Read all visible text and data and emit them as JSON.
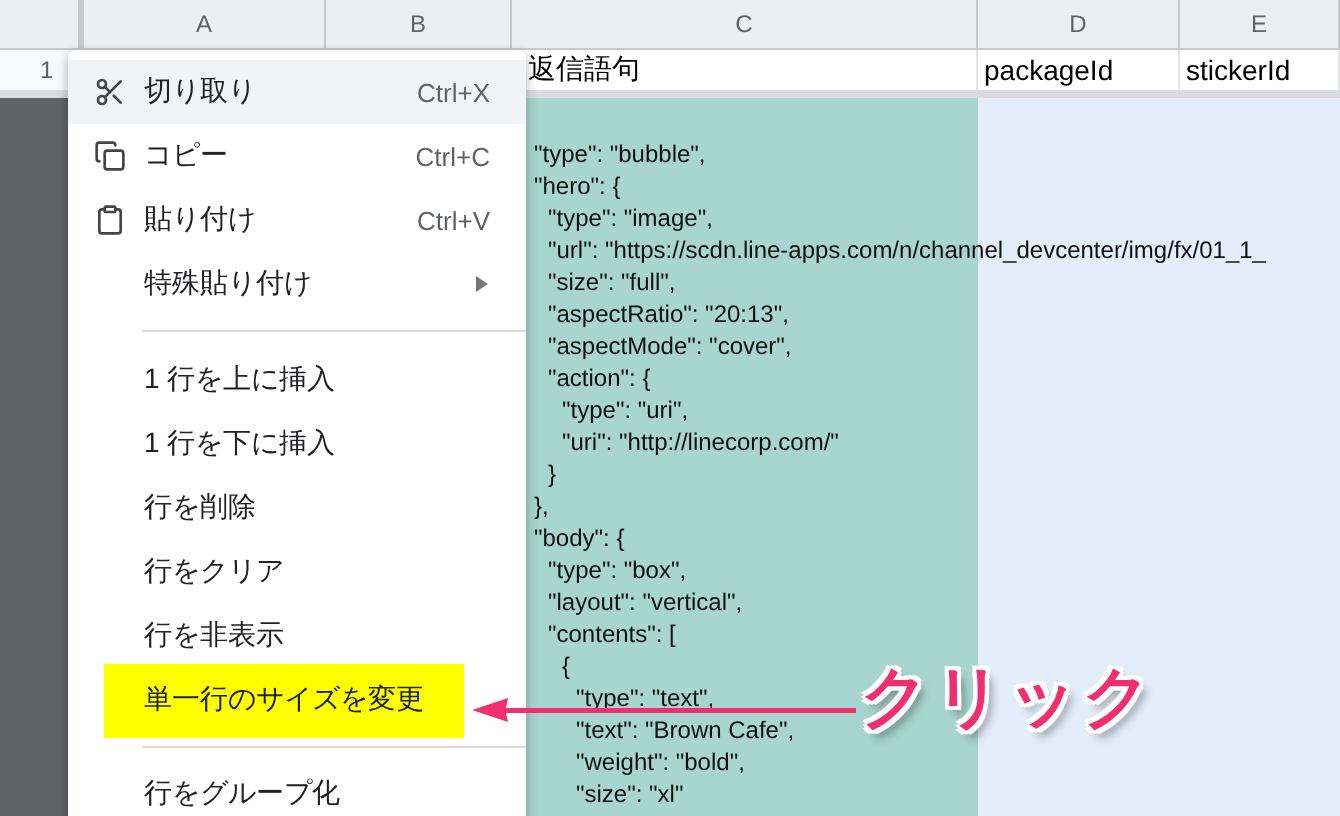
{
  "columns": [
    "A",
    "B",
    "C",
    "D",
    "E"
  ],
  "rows": [
    {
      "number": "1",
      "cells": [
        "",
        "",
        "返信語句",
        "packageId",
        "stickerId"
      ]
    }
  ],
  "cell_c2_lines": [
    {
      "text": "\"type\": \"bubble\","
    },
    {
      "text": "\"hero\": {",
      "children": [
        {
          "text": "\"type\": \"image\","
        },
        {
          "text": "\"url\": \"https://scdn.line-apps.com/n/channel_devcenter/img/fx/01_1_"
        },
        {
          "text": "\"size\": \"full\","
        },
        {
          "text": "\"aspectRatio\": \"20:13\","
        },
        {
          "text": "\"aspectMode\": \"cover\","
        },
        {
          "text": "\"action\": {",
          "children": [
            {
              "text": "\"type\": \"uri\","
            },
            {
              "text": "\"uri\": \"http://linecorp.com/\""
            }
          ]
        },
        {
          "text": "}"
        }
      ]
    },
    {
      "text": "},"
    },
    {
      "text": "\"body\": {",
      "children": [
        {
          "text": "\"type\": \"box\","
        },
        {
          "text": "\"layout\": \"vertical\","
        },
        {
          "text": "\"contents\": [",
          "children": [
            {
              "text": "{",
              "children": [
                {
                  "text": "\"type\": \"text\","
                },
                {
                  "text": "\"text\": \"Brown Cafe\","
                },
                {
                  "text": "\"weight\": \"bold\","
                },
                {
                  "text": "\"size\": \"xl\""
                }
              ]
            }
          ]
        }
      ]
    }
  ],
  "context_menu": [
    {
      "kind": "cut",
      "label": "切り取り",
      "shortcut": "Ctrl+X",
      "hovered": true,
      "highlighted": false
    },
    {
      "kind": "copy",
      "label": "コピー",
      "shortcut": "Ctrl+C",
      "hovered": false,
      "highlighted": false
    },
    {
      "kind": "paste",
      "label": "貼り付け",
      "shortcut": "Ctrl+V",
      "hovered": false,
      "highlighted": false
    },
    {
      "kind": "submenu",
      "label": "特殊貼り付け",
      "hovered": false,
      "highlighted": false
    },
    {
      "kind": "divider"
    },
    {
      "kind": "item",
      "label": "1 行を上に挿入",
      "hovered": false,
      "highlighted": false
    },
    {
      "kind": "item",
      "label": "1 行を下に挿入",
      "hovered": false,
      "highlighted": false
    },
    {
      "kind": "item",
      "label": "行を削除",
      "hovered": false,
      "highlighted": false
    },
    {
      "kind": "item",
      "label": "行をクリア",
      "hovered": false,
      "highlighted": false
    },
    {
      "kind": "item",
      "label": "行を非表示",
      "hovered": false,
      "highlighted": false
    },
    {
      "kind": "item",
      "label": "単一行のサイズを変更",
      "hovered": false,
      "highlighted": true
    },
    {
      "kind": "divider"
    },
    {
      "kind": "item",
      "label": "行をグループ化",
      "hovered": false,
      "highlighted": false
    }
  ],
  "annotation": {
    "label": "クリック"
  }
}
